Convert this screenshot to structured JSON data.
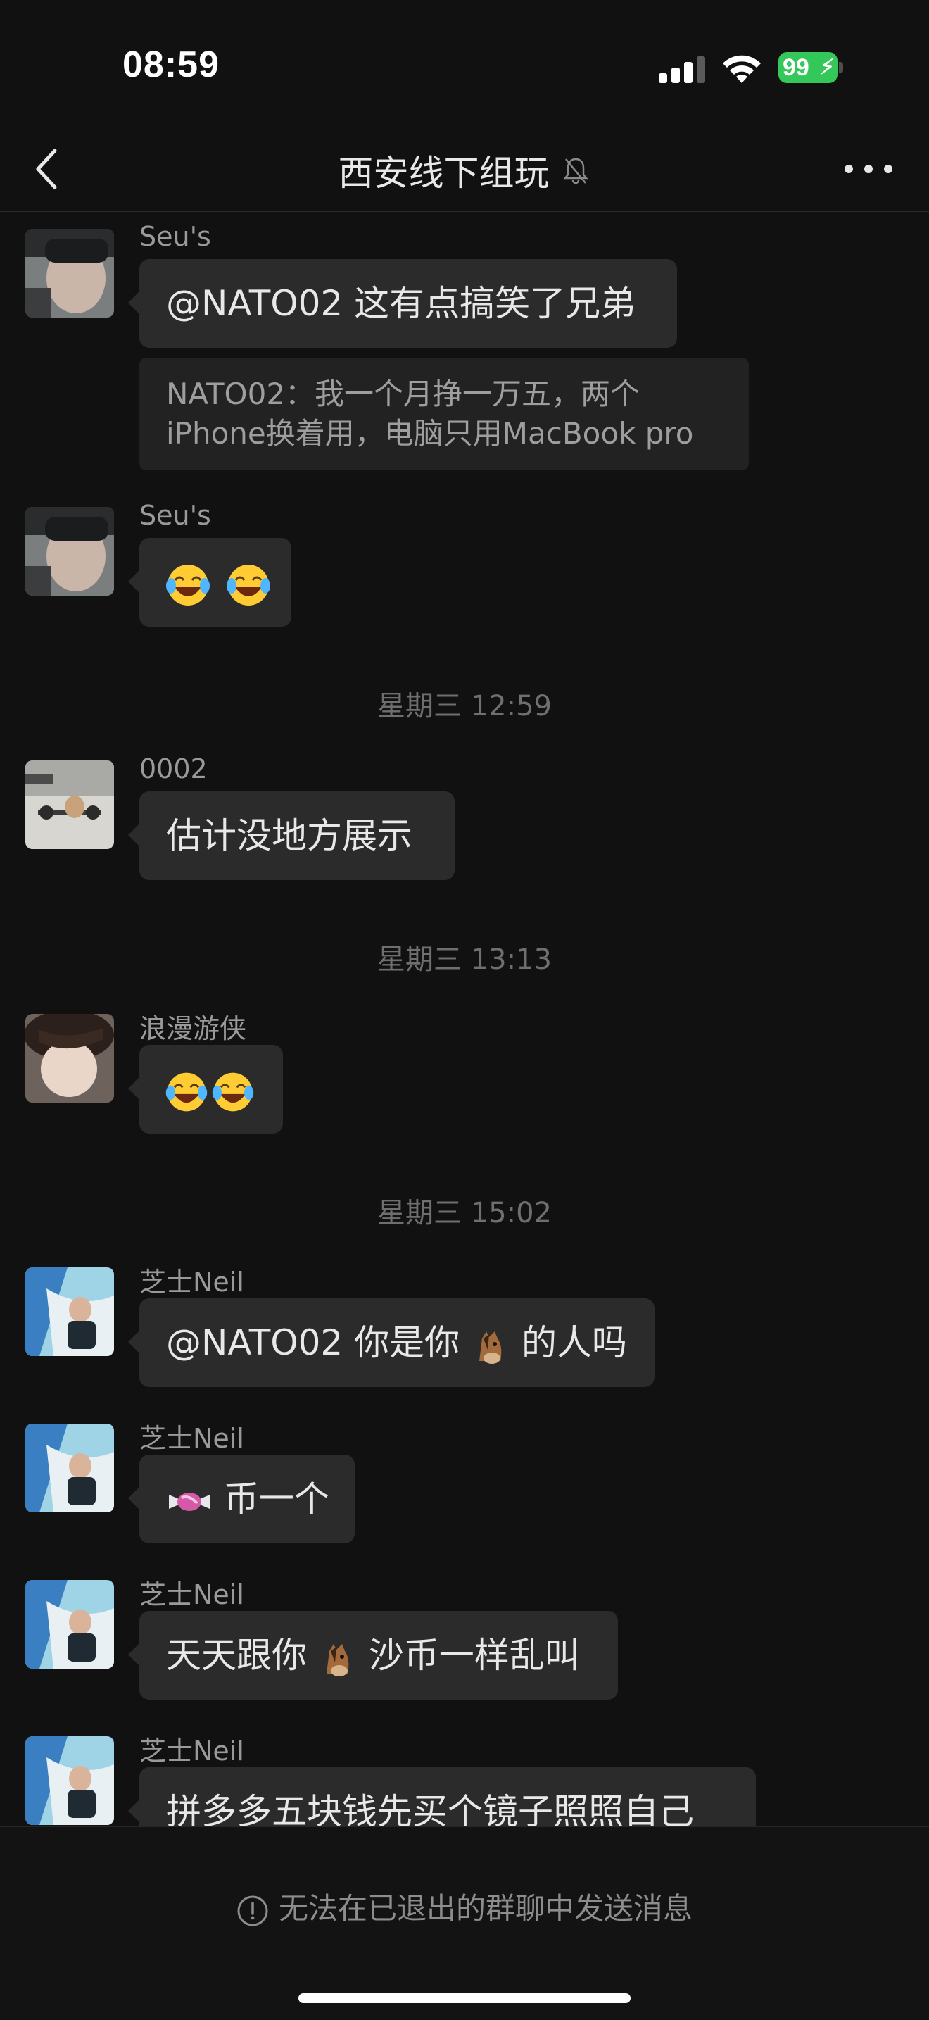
{
  "status_bar": {
    "time": "08:59",
    "battery": "99"
  },
  "nav": {
    "title": "西安线下组玩"
  },
  "messages": [
    {
      "sender": "Seu's",
      "text": "@NATO02 这有点搞笑了兄弟",
      "quote_line1": "NATO02：我一个月挣一万五，两个",
      "quote_line2": "iPhone换着用，电脑只用MacBook pro"
    },
    {
      "sender": "Seu's"
    },
    {
      "sender": "0002",
      "text": "估计没地方展示"
    },
    {
      "sender": "浪漫游侠"
    },
    {
      "sender": "芝士Neil",
      "text_before": "@NATO02 你是你",
      "text_after": "的人吗"
    },
    {
      "sender": "芝士Neil",
      "text_after": "币一个"
    },
    {
      "sender": "芝士Neil",
      "text_before": "天天跟你",
      "text_after": "沙币一样乱叫"
    },
    {
      "sender": "芝士Neil",
      "text": "拼多多五块钱先买个镜子照照自己"
    }
  ],
  "timestamps": [
    "星期三 12:59",
    "星期三 13:13",
    "星期三 15:02"
  ],
  "footer": {
    "note": "无法在已退出的群聊中发送消息"
  },
  "icons": {
    "back": "chevron-left-icon",
    "mute": "bell-slash-icon",
    "more": "ellipsis-icon",
    "info": "exclamation-circle-icon",
    "emoji_laugh": "face-with-tears-of-joy",
    "emoji_horse": "horse-face",
    "emoji_candy": "candy"
  },
  "colors": {
    "background": "#111111",
    "bubble": "#2b2b2b",
    "battery": "#34c759"
  }
}
